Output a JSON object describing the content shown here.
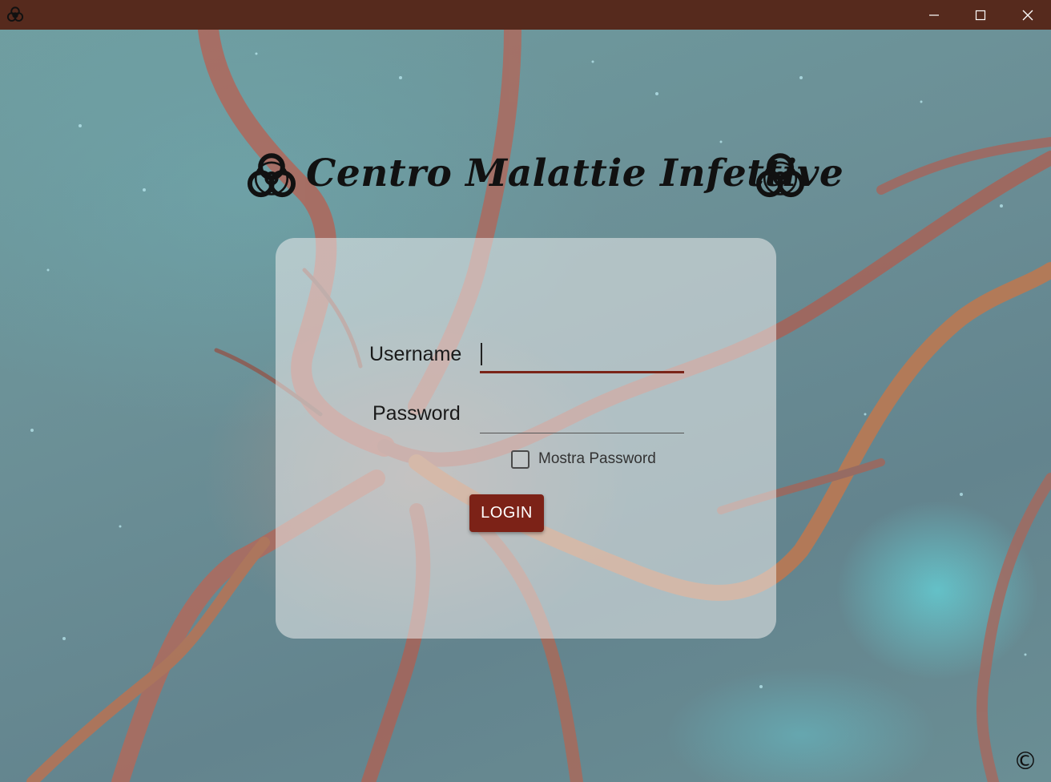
{
  "window": {
    "app_icon": "biohazard-icon",
    "controls": {
      "minimize_icon": "minimize-icon",
      "maximize_icon": "maximize-icon",
      "close_icon": "close-icon"
    },
    "title_bar_color": "#562a1d"
  },
  "header": {
    "title": "Centro Malattie Infettive",
    "left_icon": "biohazard-icon",
    "right_icon": "biohazard-icon"
  },
  "login": {
    "username_label": "Username",
    "username_value": "",
    "password_label": "Password",
    "password_value": "",
    "show_password_label": "Mostra Password",
    "show_password_checked": false,
    "login_button": "LOGIN"
  },
  "footer": {
    "copyright": "©"
  },
  "colors": {
    "accent": "#7c2217",
    "title_bar": "#562a1d"
  }
}
